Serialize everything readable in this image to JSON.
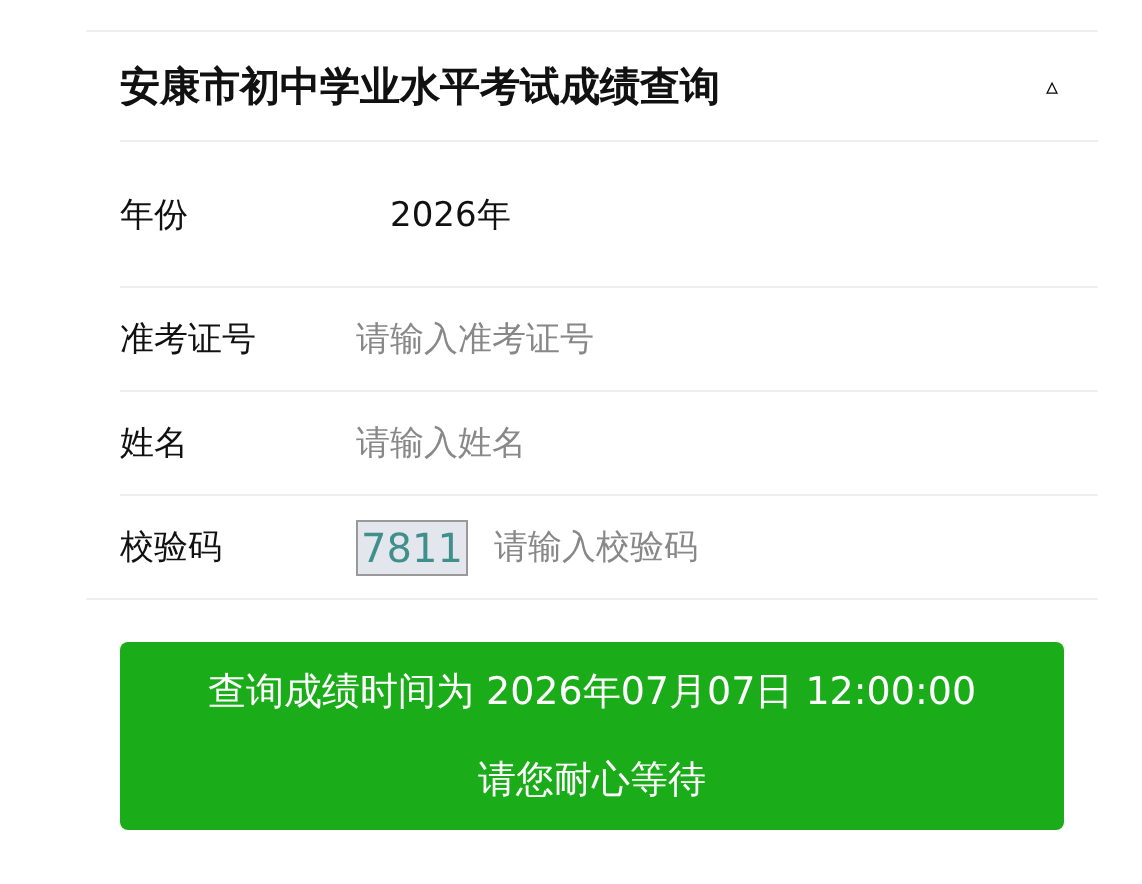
{
  "header": {
    "title": "安康市初中学业水平考试成绩查询",
    "collapse_toggle": "▵"
  },
  "fields": [
    {
      "kind": "static",
      "label": "年份",
      "value": "2026年"
    },
    {
      "kind": "input",
      "label": "准考证号",
      "placeholder": "请输入准考证号"
    },
    {
      "kind": "input",
      "label": "姓名",
      "placeholder": "请输入姓名"
    },
    {
      "kind": "captcha",
      "label": "校验码",
      "captcha": "7811",
      "placeholder": "请输入校验码"
    }
  ],
  "notice_button": {
    "lines": [
      "查询成绩时间为 2026年07月07日 12:00:00",
      "请您耐心等待"
    ]
  }
}
